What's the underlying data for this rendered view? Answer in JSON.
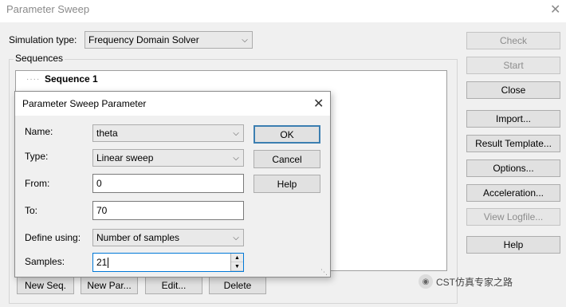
{
  "window": {
    "title": "Parameter Sweep",
    "close_glyph": "✕"
  },
  "simulation_type": {
    "label": "Simulation type:",
    "value": "Frequency Domain Solver"
  },
  "sequences": {
    "label": "Sequences",
    "items": [
      "Sequence 1"
    ]
  },
  "side_buttons": {
    "check": "Check",
    "start": "Start",
    "close": "Close",
    "import": "Import...",
    "result_template": "Result Template...",
    "options": "Options...",
    "acceleration": "Acceleration...",
    "view_logfile": "View Logfile...",
    "help": "Help"
  },
  "bottom_buttons": {
    "new_seq": "New Seq.",
    "new_par": "New Par...",
    "edit": "Edit...",
    "delete": "Delete"
  },
  "dialog": {
    "title": "Parameter Sweep Parameter",
    "close_glyph": "✕",
    "name": {
      "label": "Name:",
      "value": "theta"
    },
    "type": {
      "label": "Type:",
      "value": "Linear sweep"
    },
    "from": {
      "label": "From:",
      "value": "0"
    },
    "to": {
      "label": "To:",
      "value": "70"
    },
    "define_using": {
      "label": "Define using:",
      "value": "Number of samples"
    },
    "samples": {
      "label": "Samples:",
      "value": "21"
    },
    "buttons": {
      "ok": "OK",
      "cancel": "Cancel",
      "help": "Help"
    }
  },
  "watermark": {
    "text": "CST仿真专家之路"
  },
  "icons": {
    "dropdown": "chevron-down-icon",
    "close": "close-icon"
  }
}
